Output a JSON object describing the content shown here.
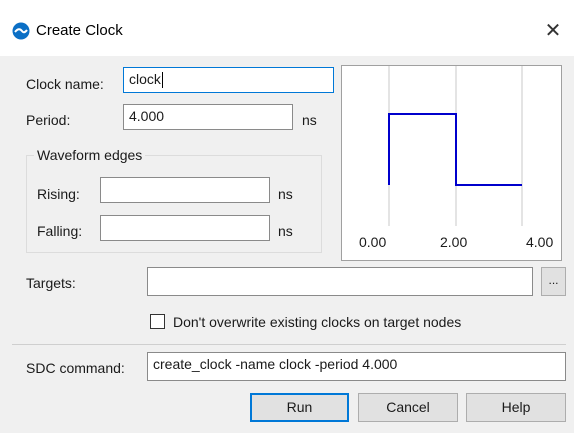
{
  "window": {
    "title": "Create Clock",
    "close_glyph": "✕",
    "accent": "#0078d7"
  },
  "form": {
    "clock_name_label": "Clock name:",
    "clock_name_value": "clock",
    "period_label": "Period:",
    "period_value": "4.000",
    "period_unit": "ns",
    "waveform_group_label": "Waveform edges",
    "rising_label": "Rising:",
    "rising_value": "",
    "rising_unit": "ns",
    "falling_label": "Falling:",
    "falling_value": "",
    "falling_unit": "ns",
    "targets_label": "Targets:",
    "targets_value": "",
    "browse_label": "...",
    "dont_overwrite_label": "Don't overwrite existing clocks on target nodes",
    "dont_overwrite_checked": false,
    "sdc_label": "SDC command:",
    "sdc_value": "create_clock -name clock -period 4.000"
  },
  "waveform_preview": {
    "tick_labels": [
      "0.00",
      "2.00",
      "4.00"
    ],
    "waveform_color": "#0000cc"
  },
  "buttons": {
    "run": "Run",
    "cancel": "Cancel",
    "help": "Help"
  }
}
